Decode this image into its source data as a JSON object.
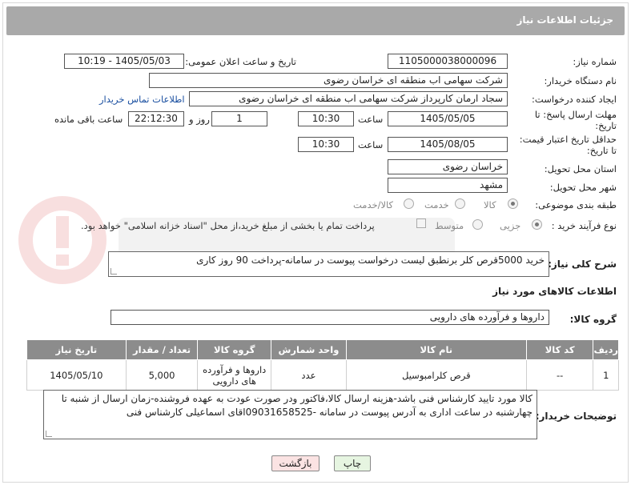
{
  "header": {
    "title": "جزئیات اطلاعات نیاز"
  },
  "fields": {
    "need_number_label": "شماره نیاز:",
    "need_number": "1105000038000096",
    "announce_label": "تاریخ و ساعت اعلان عمومی:",
    "announce_value": "1405/05/03 - 10:19",
    "buyer_org_label": "نام دستگاه خریدار:",
    "buyer_org": "شرکت سهامی اب منطقه ای خراسان رضوی",
    "creator_label": "ایجاد کننده درخواست:",
    "creator": "سجاد ارمان کارپرداز شرکت سهامی اب منطقه ای خراسان رضوی",
    "contact_link": "اطلاعات تماس خریدار",
    "reply_deadline_label": "مهلت ارسال پاسخ: تا تاریخ:",
    "reply_date": "1405/05/05",
    "time_label": "ساعت",
    "reply_time": "10:30",
    "days_value": "1",
    "days_label": "روز و",
    "remaining_time": "22:12:30",
    "remaining_label": "ساعت باقی مانده",
    "price_valid_label": "حداقل تاریخ اعتبار قیمت: تا تاریخ:",
    "price_date": "1405/08/05",
    "price_time_label": "ساعت",
    "price_time": "10:30",
    "province_label": "استان محل تحویل:",
    "province": "خراسان رضوی",
    "city_label": "شهر محل تحویل:",
    "city": "مشهد",
    "category_label": "طبقه بندی موضوعی:",
    "category_options": [
      "کالا",
      "خدمت",
      "کالا/خدمت"
    ],
    "process_label": "نوع فرآیند خرید :",
    "process_options": [
      "جزیی",
      "متوسط"
    ],
    "payment_note": "پرداخت تمام یا بخشی از مبلغ خرید،از محل \"اسناد خزانه اسلامی\" خواهد بود."
  },
  "description": {
    "label": "شرح کلی نیاز:",
    "text": "خرید 5000قرص کلر برنطبق لیست درخواست پیوست در سامانه-پرداخت 90 روز کاری"
  },
  "goods_section": {
    "title": "اطلاعات کالاهای مورد نیاز",
    "group_label": "گروه کالا:",
    "group_value": "داروها و فرآورده های دارویی"
  },
  "table": {
    "headers": [
      "ردیف",
      "کد کالا",
      "نام کالا",
      "واحد شمارش",
      "گروه کالا",
      "تعداد / مقدار",
      "تاریخ نیاز"
    ],
    "rows": [
      [
        "1",
        "--",
        "قرص کلرامبوسیل",
        "عدد",
        "داروها و فرآورده های دارویی",
        "5,000",
        "1405/05/10"
      ]
    ]
  },
  "buyer_notes": {
    "label": "توضیحات خریدار:",
    "text": "کالا مورد تایید کارشناس فنی باشد-هزینه ارسال کالا،فاکتور ودر صورت عودت به عهده فروشنده-زمان ارسال از شنبه تا چهارشنبه در ساعت اداری به آدرس پیوست در سامانه -09031658525اقای اسماعیلی کارشناس فنی"
  },
  "buttons": {
    "print": "چاپ",
    "back": "بازگشت"
  },
  "colors": {
    "header_bg": "#a9a9a9",
    "table_header_bg": "#8c8c8c",
    "print_bg": "#e6f5e1",
    "back_bg": "#fbe3e3"
  }
}
